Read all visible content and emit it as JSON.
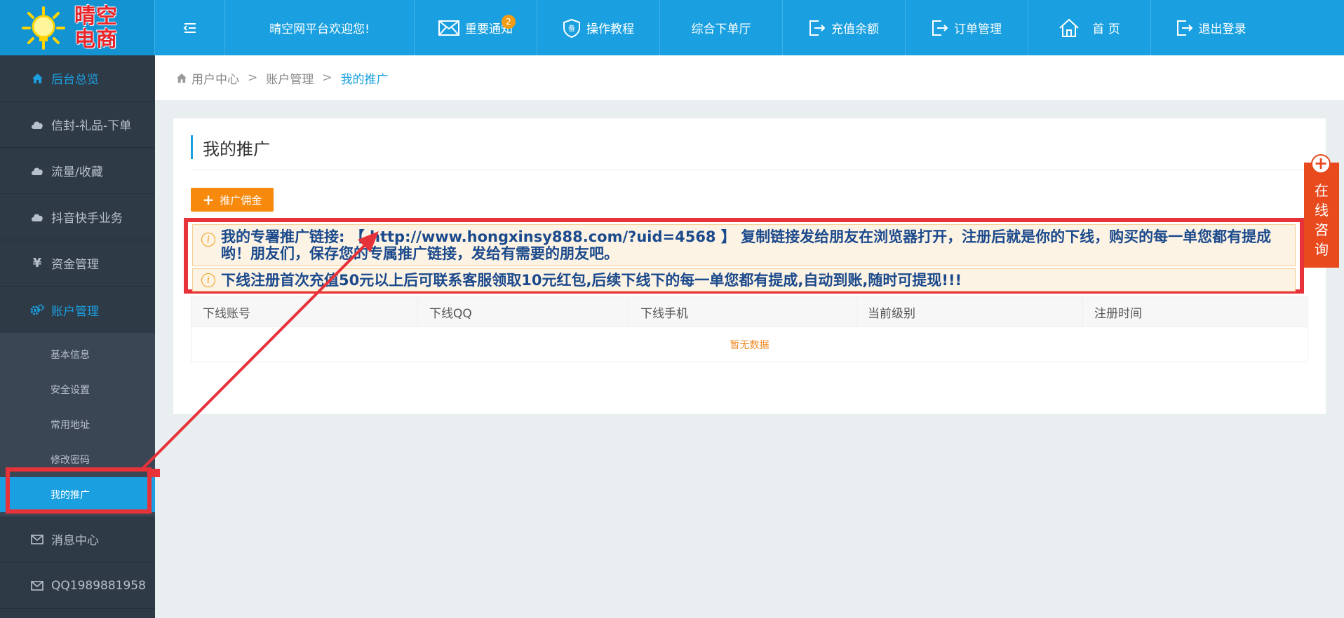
{
  "header": {
    "logo": "晴空电商",
    "welcome": "晴空网平台欢迎您!",
    "nav": [
      {
        "label": "重要通知",
        "icon": "envelope-icon",
        "badge": "2"
      },
      {
        "label": "操作教程",
        "icon": "shield-icon"
      },
      {
        "label": "综合下单厅",
        "icon": ""
      },
      {
        "label": "充值余额",
        "icon": "exit-icon"
      },
      {
        "label": "订单管理",
        "icon": "exit-icon"
      },
      {
        "label": "首 页",
        "icon": "home-icon"
      },
      {
        "label": "退出登录",
        "icon": "exit-icon"
      }
    ]
  },
  "sidebar": {
    "items": [
      {
        "label": "后台总览",
        "icon": "home-icon"
      },
      {
        "label": "信封-礼品-下单",
        "icon": "cloud-icon"
      },
      {
        "label": "流量/收藏",
        "icon": "cloud-icon"
      },
      {
        "label": "抖音快手业务",
        "icon": "cloud-icon"
      },
      {
        "label": "资金管理",
        "icon": "yen-icon"
      },
      {
        "label": "账户管理",
        "icon": "gears-icon"
      }
    ],
    "sub_items": [
      {
        "label": "基本信息"
      },
      {
        "label": "安全设置"
      },
      {
        "label": "常用地址"
      },
      {
        "label": "修改密码"
      },
      {
        "label": "我的推广"
      }
    ],
    "bottom_items": [
      {
        "label": "消息中心",
        "icon": "envelope-icon"
      },
      {
        "label": "QQ1989881958",
        "icon": "envelope-icon"
      }
    ]
  },
  "breadcrumb": {
    "home": "用户中心",
    "middle": "账户管理",
    "current": "我的推广"
  },
  "main": {
    "title": "我的推广",
    "commission_button": "推广佣金",
    "notice1": "我的专署推广链接: 【 http://www.hongxinsy888.com/?uid=4568 】 复制链接发给朋友在浏览器打开，注册后就是你的下线，购买的每一单您都有提成哟！朋友们，保存您的专属推广链接，发给有需要的朋友吧。",
    "notice2": "下线注册首次充值50元以上后可联系客服领取10元红包,后续下线下的每一单您都有提成,自动到账,随时可提现!!!",
    "table_headers": [
      "下线账号",
      "下线QQ",
      "下线手机",
      "当前级别",
      "注册时间"
    ],
    "empty_text": "暂无数据"
  },
  "consult": {
    "label_chars": [
      "在",
      "线",
      "咨",
      "询"
    ]
  },
  "colors": {
    "primary": "#1aa0e0",
    "sidebar": "#2f3a47",
    "accent_orange": "#f7890d",
    "highlight_red": "#e8323a",
    "notice_text": "#1b4a8c"
  }
}
